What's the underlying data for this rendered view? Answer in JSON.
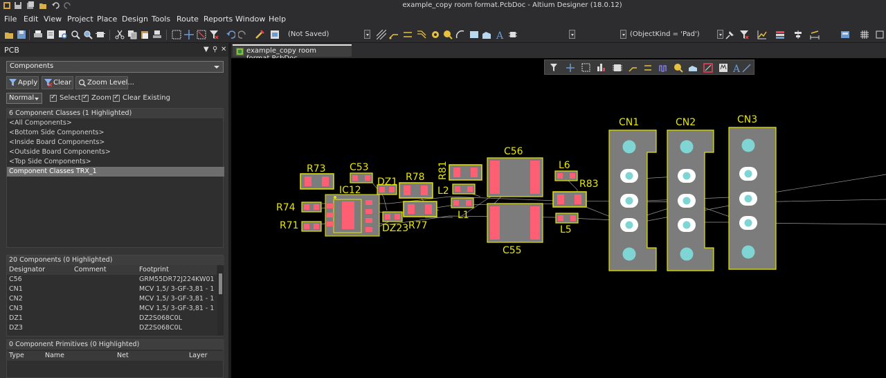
{
  "window": {
    "title": "example_copy room format.PcbDoc - Altium Designer (18.0.12)"
  },
  "menu": [
    "File",
    "Edit",
    "View",
    "Project",
    "Place",
    "Design",
    "Tools",
    "Route",
    "Reports",
    "Window",
    "Help"
  ],
  "toolbar": {
    "save_state": "(Not Saved)",
    "filter_text": "(ObjectKind = 'Pad')"
  },
  "panel": {
    "title": "PCB",
    "mode_select": "Components",
    "buttons": {
      "apply": "Apply",
      "clear": "Clear",
      "zoom": "Zoom Level..."
    },
    "highlight_mode": "Normal",
    "checks": {
      "select": "Select",
      "zoom": "Zoom",
      "clear_existing": "Clear Existing"
    },
    "classes": {
      "header": "6 Component Classes (1 Highlighted)",
      "items": [
        "<All Components>",
        "<Bottom Side Components>",
        "<Inside Board Components>",
        "<Outside Board Components>",
        "<Top Side Components>",
        "Component Classes TRX_1"
      ],
      "selected_index": 5
    },
    "components": {
      "header": "20 Components (0 Highlighted)",
      "columns": [
        "Designator",
        "Comment",
        "Footprint"
      ],
      "rows": [
        {
          "designator": "C56",
          "comment": "",
          "footprint": "GRM55DR72J224KW01"
        },
        {
          "designator": "CN1",
          "comment": "",
          "footprint": "MCV 1,5/ 3-GF-3,81 - 1"
        },
        {
          "designator": "CN2",
          "comment": "",
          "footprint": "MCV 1,5/ 3-GF-3,81 - 1"
        },
        {
          "designator": "CN3",
          "comment": "",
          "footprint": "MCV 1,5/ 3-GF-3,81 - 1"
        },
        {
          "designator": "DZ1",
          "comment": "",
          "footprint": "DZ2S068C0L"
        },
        {
          "designator": "DZ3",
          "comment": "",
          "footprint": "DZ2S068C0L"
        }
      ]
    },
    "primitives": {
      "header": "0 Component Primitives (0 Highlighted)",
      "columns": [
        "Type",
        "Name",
        "Net",
        "Layer"
      ]
    }
  },
  "document_tab": "example_copy room format.PcbDoc",
  "pcb_labels": {
    "cn1": "CN1",
    "cn2": "CN2",
    "cn3": "CN3",
    "c56": "C56",
    "c55": "C55",
    "c53": "C53",
    "r73": "R73",
    "r74": "R74",
    "r71": "R71",
    "r78": "R78",
    "r77": "R77",
    "r81": "R81",
    "r83": "R83",
    "ic12": "IC12",
    "dz1": "DZ1",
    "dz3": "DZ23",
    "l1": "L1",
    "l2": "L2",
    "l5": "L5",
    "l6": "L6"
  },
  "colors": {
    "board_bg": "#000000",
    "silk": "#e6e600",
    "pad": "#ff5f73",
    "body": "#7c7c7c",
    "through_hole": "#7fd4d4",
    "panel_bg": "#353535"
  }
}
